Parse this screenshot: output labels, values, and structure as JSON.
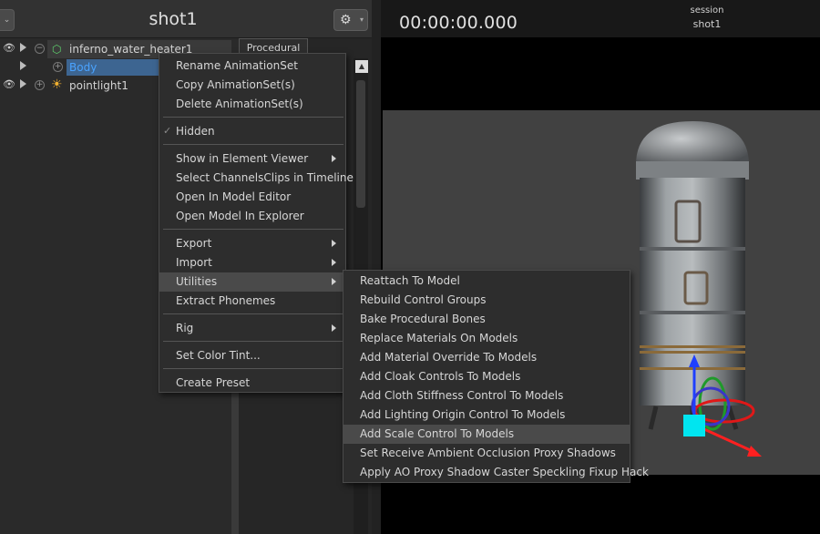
{
  "left_panel": {
    "title": "shot1",
    "menu_caret": "⌄",
    "gear_glyph": "⚙",
    "gear_caret": "▾",
    "tree": [
      {
        "label": "inferno_water_heater1",
        "icon": "model-cube-icon"
      },
      {
        "label": "Body",
        "icon": "plus-circle-icon",
        "selected": true
      },
      {
        "label": "pointlight1",
        "icon": "light-sun-icon"
      }
    ],
    "procedural_tab": "Procedural"
  },
  "viewport": {
    "timecode": "00:00:00.000",
    "session_label": "session",
    "session_name": "shot1"
  },
  "context_menu": {
    "items": [
      {
        "label": "Rename AnimationSet"
      },
      {
        "label": "Copy AnimationSet(s)"
      },
      {
        "label": "Delete AnimationSet(s)"
      },
      {
        "label": "Hidden",
        "checked": true
      },
      {
        "label": "Show in Element Viewer",
        "submenu": true
      },
      {
        "label": "Select ChannelsClips in Timeline"
      },
      {
        "label": "Open In Model Editor"
      },
      {
        "label": "Open Model In Explorer"
      },
      {
        "label": "Export",
        "submenu": true
      },
      {
        "label": "Import",
        "submenu": true
      },
      {
        "label": "Utilities",
        "submenu": true,
        "highlighted": true
      },
      {
        "label": "Extract Phonemes"
      },
      {
        "label": "Rig",
        "submenu": true
      },
      {
        "label": "Set Color Tint..."
      },
      {
        "label": "Create Preset"
      }
    ],
    "check_glyph": "✓"
  },
  "utilities_menu": {
    "items": [
      {
        "label": "Reattach To Model"
      },
      {
        "label": "Rebuild Control Groups"
      },
      {
        "label": "Bake Procedural Bones"
      },
      {
        "label": "Replace Materials On Models"
      },
      {
        "label": "Add Material Override To Models"
      },
      {
        "label": "Add Cloak Controls To Models"
      },
      {
        "label": "Add Cloth Stiffness Control To Models"
      },
      {
        "label": "Add Lighting Origin Control To Models"
      },
      {
        "label": "Add Scale Control To Models",
        "highlighted": true
      },
      {
        "label": "Set Receive Ambient Occlusion Proxy Shadows"
      },
      {
        "label": "Apply AO Proxy Shadow Caster Speckling Fixup Hack"
      }
    ]
  },
  "colors": {
    "selection": "#3d6591",
    "selected_text": "#4aa3ff",
    "menu_highlight": "#4a4a4a",
    "gizmo_up": "#1f3fff",
    "gizmo_right": "#ff2020",
    "gizmo_handle": "#00e5f0"
  }
}
